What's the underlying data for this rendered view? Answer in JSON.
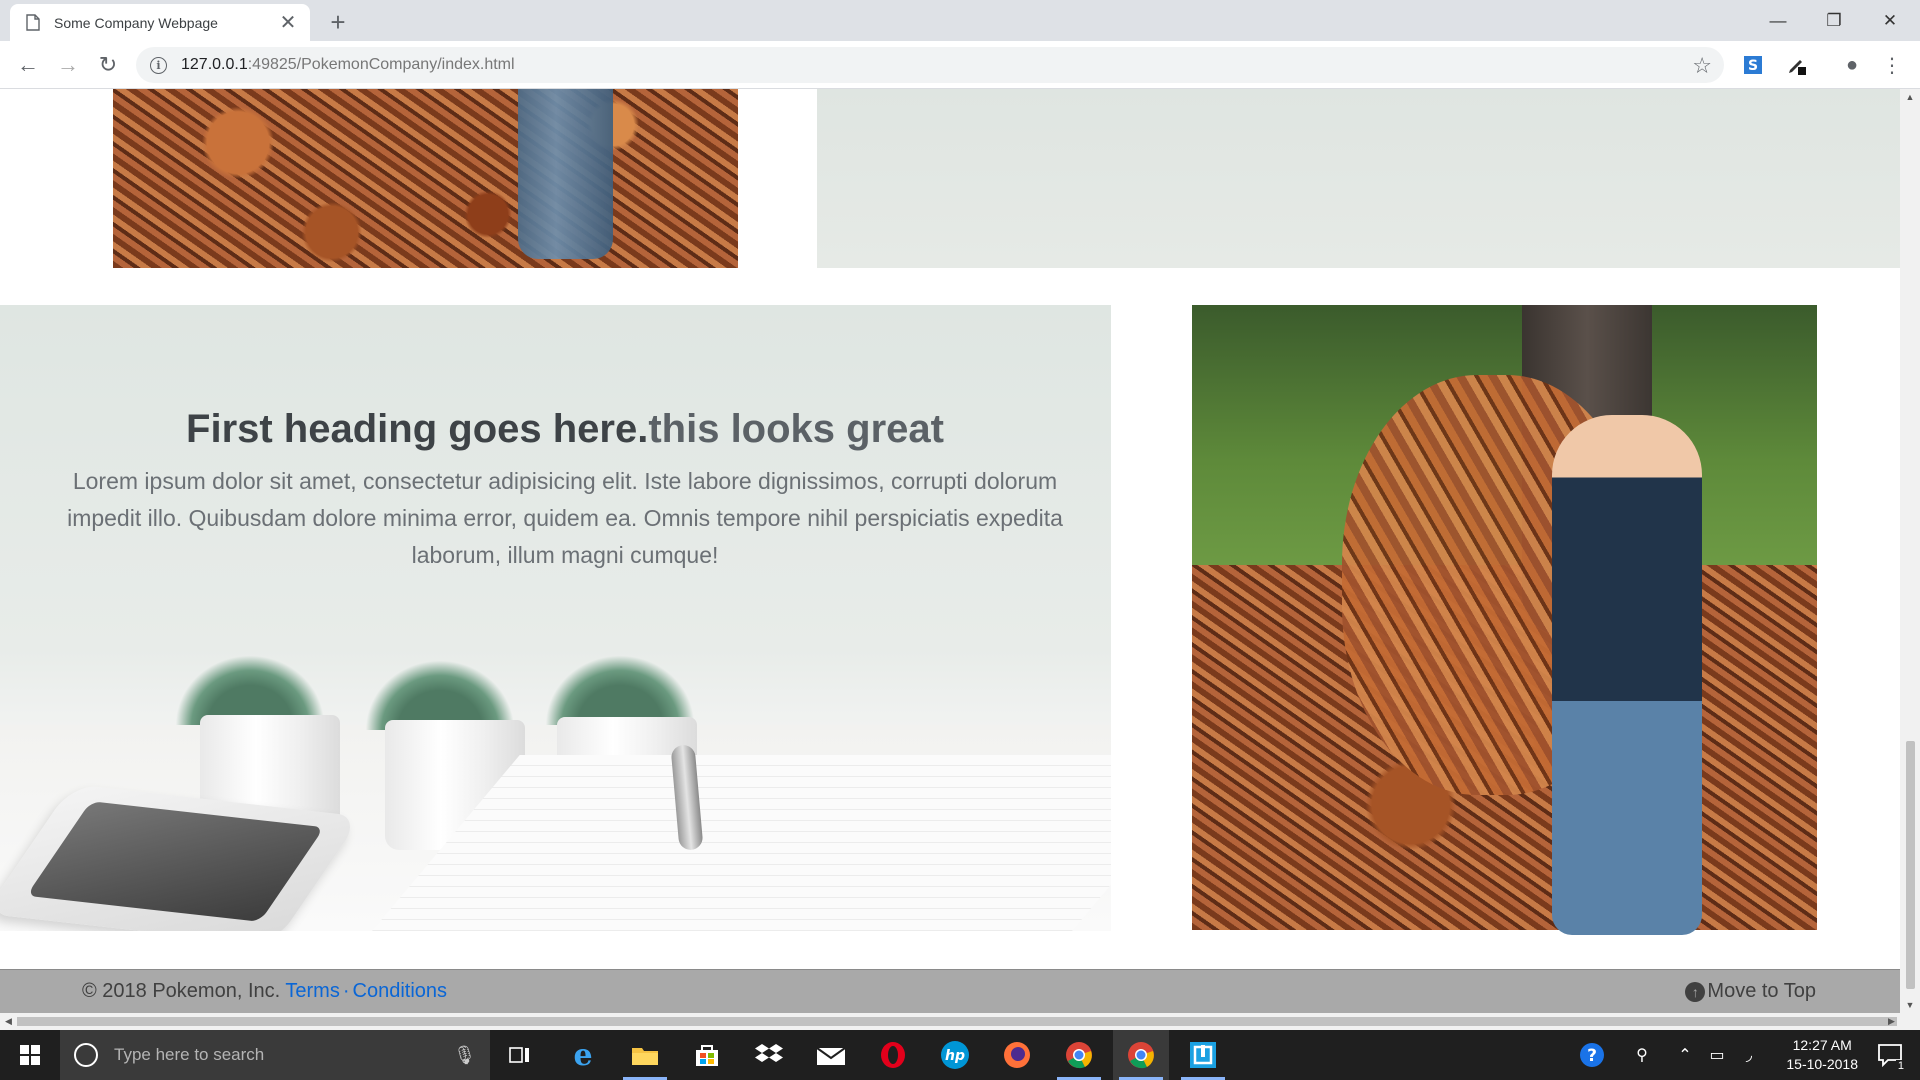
{
  "browser": {
    "tab_title": "Some Company Webpage",
    "new_tab_symbol": "+",
    "url_host": "127.0.0.1",
    "url_rest": ":49825/PokemonCompany/index.html",
    "icons": [
      "doc-icon",
      "close-icon",
      "back-icon",
      "forward-icon",
      "reload-icon",
      "info-icon",
      "star-icon",
      "extension-icon",
      "profile-icon",
      "menu-icon"
    ]
  },
  "hero": {
    "heading_main": "First heading goes here.",
    "heading_accent": "this looks great",
    "body": "Lorem ipsum dolor sit amet, consectetur adipisicing elit. Iste labore dignissimos, corrupti dolorum impedit illo. Quibusdam dolore minima error, quidem ea. Omnis tempore nihil perspiciatis expedita laborum, illum magni cumque!"
  },
  "footer": {
    "copyright": "© 2018 Pokemon, Inc.",
    "terms": "Terms",
    "separator": "·",
    "conditions": "Conditions",
    "move_to_top": "Move to Top"
  },
  "taskbar": {
    "search_placeholder": "Type here to search",
    "time": "12:27 AM",
    "date": "15-10-2018",
    "notification_count": "1"
  },
  "colors": {
    "link": "#0a66d6",
    "footer_bg": "#a9a9a9",
    "heading": "#3e4347"
  }
}
